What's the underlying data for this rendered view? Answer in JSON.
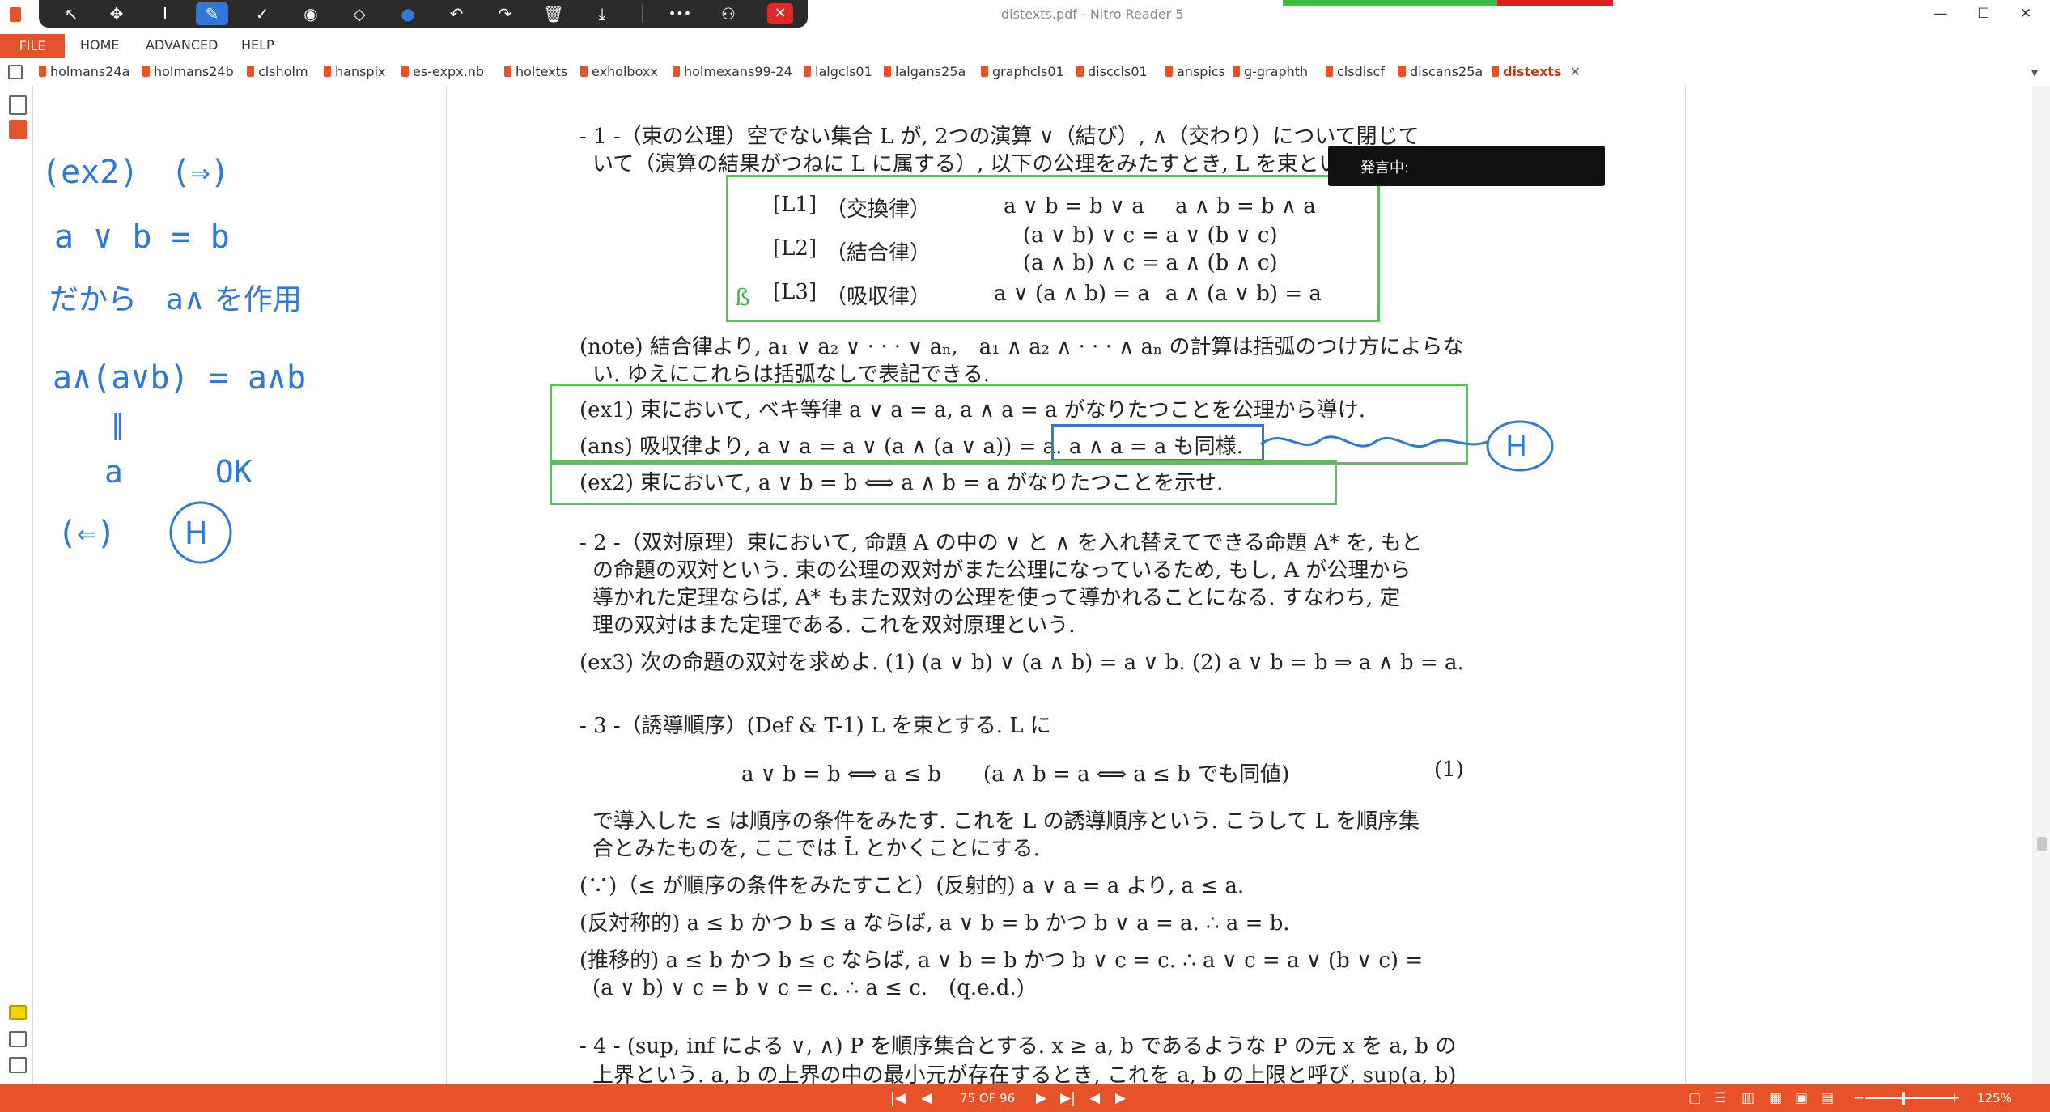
{
  "window": {
    "title": "distexts.pdf - Nitro Reader 5",
    "min_glyph": "—",
    "max_glyph": "☐",
    "close_glyph": "✕"
  },
  "ink_toolbar": {
    "tools": [
      {
        "name": "select-arrow-icon",
        "glyph": "↖"
      },
      {
        "name": "pan-icon",
        "glyph": "✥"
      },
      {
        "name": "text-cursor-icon",
        "glyph": "I"
      },
      {
        "name": "pen-icon",
        "glyph": "✎"
      },
      {
        "name": "check-icon",
        "glyph": "✓"
      },
      {
        "name": "stamp-icon",
        "glyph": "◉"
      },
      {
        "name": "eraser-icon",
        "glyph": "◇"
      },
      {
        "name": "color-dot-icon",
        "glyph": "●"
      },
      {
        "name": "undo-icon",
        "glyph": "↶"
      },
      {
        "name": "redo-icon",
        "glyph": "↷"
      },
      {
        "name": "trash-icon",
        "glyph": "🗑"
      },
      {
        "name": "download-icon",
        "glyph": "⤓"
      },
      {
        "name": "more-icon",
        "glyph": "•••"
      },
      {
        "name": "share-user-icon",
        "glyph": "⚇"
      }
    ],
    "close_glyph": "✕"
  },
  "menu": {
    "file": "FILE",
    "home": "HOME",
    "advanced": "ADVANCED",
    "help": "HELP"
  },
  "tabs": [
    "holmans24a",
    "holmans24b",
    "clsholm",
    "hanspix",
    "es-expx.nb",
    "holtexts",
    "exholboxx",
    "holmexans99-24",
    "lalgcls01",
    "lalgans25a",
    "graphcls01",
    "disccls01",
    "anspics",
    "g-graphth",
    "clsdiscf",
    "discans25a"
  ],
  "active_tab": "distexts",
  "tab_close_glyph": "✕",
  "tab_overflow_glyph": "▾",
  "speech_indicator": {
    "label": "発言中:"
  },
  "handwritten_notes": {
    "color": "#2f77d8",
    "lines": [
      "(ex2)　(⇒)",
      "a ∨ b = b",
      "だから　a∧ を作用",
      "a∧(a∨b) = a∧b",
      "‖",
      "a　　　OK",
      "(⇐)",
      "H"
    ]
  },
  "doc": {
    "s1": {
      "line1": "- 1 -（束の公理）空でない集合 L が, 2つの演算 ∨（結び）, ∧（交わり）について閉じて",
      "line2": "いて（演算の結果がつねに L に属する）, 以下の公理をみたすとき, L を束という.",
      "axioms": [
        {
          "label": "[L1]",
          "name": "（交換律）",
          "f1": "a ∨ b = b ∨ a",
          "f2": "a ∧ b = b ∧ a"
        },
        {
          "label": "[L2]",
          "name": "（結合律）",
          "f1": "(a ∨ b) ∨ c = a ∨ (b ∨ c)",
          "f2": "(a ∧ b) ∧ c = a ∧ (b ∧ c)"
        },
        {
          "label": "[L3]",
          "name": "（吸収律）",
          "f1": "a ∨ (a ∧ b) = a",
          "f2": "a ∧ (a ∨ b) = a"
        }
      ],
      "l3_mark": "ß",
      "note1": "(note) 結合律より, a₁ ∨ a₂ ∨ · · · ∨ aₙ,　a₁ ∧ a₂ ∧ · · · ∧ aₙ の計算は括弧のつけ方によらな",
      "note2": "い. ゆえにこれらは括弧なしで表記できる.",
      "ex1": "(ex1) 束において, ベキ等律 a ∨ a = a,  a ∧ a = a がなりたつことを公理から導け.",
      "ans1": "(ans) 吸収律より, a ∨ a = a ∨ (a ∧ (a ∨ a)) = a.",
      "ans1_box": "a ∧ a = a も同様.",
      "ann_h": "H",
      "ex2": "(ex2) 束において, a ∨ b = b ⟺ a ∧ b = a がなりたつことを示せ."
    },
    "s2": {
      "l1": "- 2 -（双対原理）束において, 命題 A の中の ∨ と ∧ を入れ替えてできる命題 A* を, もと",
      "l2": "の命題の双対という. 束の公理の双対がまた公理になっているため, もし, A が公理から",
      "l3": "導かれた定理ならば, A* もまた双対の公理を使って導かれることになる. すなわち, 定",
      "l4": "理の双対はまた定理である. これを双対原理という.",
      "ex3": "(ex3) 次の命題の双対を求めよ. (1) (a ∨ b) ∨ (a ∧ b) = a ∨ b. (2) a ∨ b = b ⇒ a ∧ b = a."
    },
    "s3": {
      "l1": "- 3 -（誘導順序）(Def & T-1) L を束とする. L に",
      "eq": "a ∨ b = b ⟺ a ≤ b　　(a ∧ b = a ⟺ a ≤ b でも同値)",
      "eqno": "(1)",
      "l2": "で導入した ≤ は順序の条件をみたす. これを L の誘導順序という. こうして L を順序集",
      "l3": "合とみたものを, ここでは L̄ とかくことにする.",
      "l4": "(∵)（≤ が順序の条件をみたすこと）(反射的) a ∨ a = a より, a ≤ a.",
      "l5": "(反対称的) a ≤ b かつ b ≤ a ならば, a ∨ b = b かつ b ∨ a = a.  ∴  a = b.",
      "l6": "(推移的) a ≤ b かつ b ≤ c ならば, a ∨ b = b かつ b ∨ c = c.  ∴  a ∨ c = a ∨ (b ∨ c) =",
      "l7": "(a ∨ b) ∨ c = b ∨ c = c.  ∴  a ≤ c.　(q.e.d.)"
    },
    "s4": {
      "l1": "- 4 - (sup, inf による ∨, ∧) P を順序集合とする. x ≥ a, b であるような P の元 x を a, b の",
      "l2": "上界という. a, b の上界の中の最小元が存在するとき, これを a, b の上限と呼び, sup(a, b)"
    }
  },
  "status": {
    "first_glyph": "|◀",
    "prev_glyph": "◀",
    "page_indicator": "75 OF 96",
    "next_glyph": "▶",
    "last_glyph": "▶|",
    "back_glyph": "◀",
    "fwd_glyph": "▶",
    "view_glyphs": [
      "▢",
      "☰",
      "▥",
      "▦",
      "▣",
      "▤"
    ],
    "zoom_minus": "−",
    "zoom_plus": "+",
    "zoom_level": "125%"
  }
}
